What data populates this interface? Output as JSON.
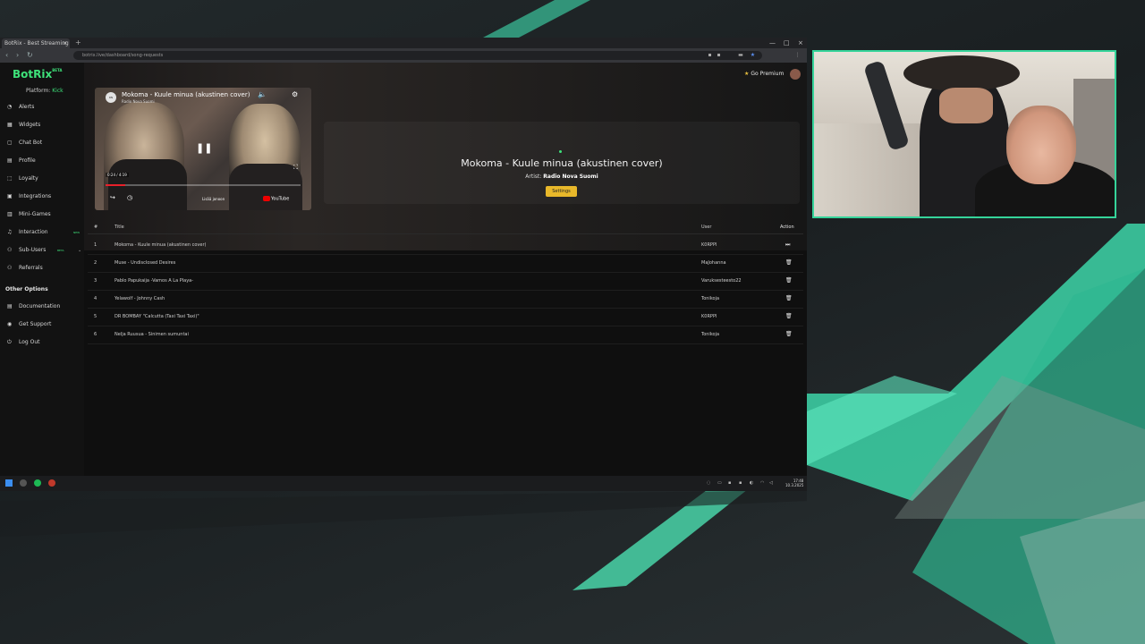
{
  "browser": {
    "tab_title": "BotRix - Best Streaming",
    "tab_close": "×",
    "new_tab": "+",
    "url": "botrix.live/dashboard/song-requests",
    "window_controls": [
      "—",
      "□",
      "×"
    ]
  },
  "app": {
    "logo": "BotRix",
    "logo_sup": "BETA",
    "platform_label": "Platform:",
    "platform_value": "Kick",
    "go_premium": "Go Premium",
    "nav": [
      {
        "label": "Alerts",
        "icon": "alerts-icon",
        "glyph": "◔"
      },
      {
        "label": "Widgets",
        "icon": "widgets-icon",
        "glyph": "▦"
      },
      {
        "label": "Chat Bot",
        "icon": "chat-bot-icon",
        "glyph": "▢"
      },
      {
        "label": "Profile",
        "icon": "profile-icon",
        "glyph": "▤"
      },
      {
        "label": "Loyalty",
        "icon": "loyalty-icon",
        "glyph": "⬚"
      },
      {
        "label": "Integrations",
        "icon": "integrations-icon",
        "glyph": "▣"
      },
      {
        "label": "Mini-Games",
        "icon": "mini-games-icon",
        "glyph": "▥"
      },
      {
        "label": "Interaction",
        "icon": "music-icon",
        "glyph": "♫",
        "badge": "NEW"
      },
      {
        "label": "Sub-Users",
        "icon": "users-icon",
        "glyph": "⚇",
        "beta": "BETA",
        "chevron": "⌄"
      },
      {
        "label": "Referrals",
        "icon": "referrals-icon",
        "glyph": "⚇"
      }
    ],
    "other_options_heading": "Other Options",
    "other_nav": [
      {
        "label": "Documentation",
        "icon": "documentation-icon",
        "glyph": "▤"
      },
      {
        "label": "Get Support",
        "icon": "support-icon",
        "glyph": "◉"
      },
      {
        "label": "Log Out",
        "icon": "logout-icon",
        "glyph": "⏻"
      }
    ]
  },
  "video": {
    "title": "Mokoma - Kuule minua (akustinen cover)",
    "channel": "Radio Nova Suomi",
    "time": "0:24 / 4:19",
    "progress": 0.1,
    "youtube_label": "YouTube",
    "later_label": "Lisää jonoon"
  },
  "now_playing": {
    "song": "Mokoma - Kuule minua (akustinen cover)",
    "artist_label": "Artist:",
    "artist": "Radio Nova Suomi",
    "settings_button": "Settings"
  },
  "queue": {
    "headers": {
      "num": "#",
      "title": "Title",
      "user": "User",
      "action": "Action"
    },
    "rows": [
      {
        "num": "1",
        "title": "Mokoma - Kuule minua (akustinen cover)",
        "user": "K0RPPI",
        "action_icon": "skip-icon",
        "glyph": "⏭"
      },
      {
        "num": "2",
        "title": "Muse - Undisclosed Desires",
        "user": "MaJohanna",
        "action_icon": "trash-icon",
        "glyph": "🗑"
      },
      {
        "num": "3",
        "title": "Pablo Papukaija -Vamos A La Playa-",
        "user": "Varuksesteesto22",
        "action_icon": "trash-icon",
        "glyph": "🗑"
      },
      {
        "num": "4",
        "title": "Yelawolf - Johnny Cash",
        "user": "Tonikoja",
        "action_icon": "trash-icon",
        "glyph": "🗑"
      },
      {
        "num": "5",
        "title": "DR BOMBAY \"Calcutta (Taxi Taxi Taxi)\"",
        "user": "K0RPPI",
        "action_icon": "trash-icon",
        "glyph": "🗑"
      },
      {
        "num": "6",
        "title": "Nelja Ruusua - Sinimen sumuntai",
        "user": "Tonikoja",
        "action_icon": "trash-icon",
        "glyph": "🗑"
      }
    ]
  },
  "taskbar": {
    "time": "17:48",
    "date": "10.3.2025"
  },
  "colors": {
    "accent": "#3ee27a",
    "settings_button": "#e8b82a",
    "webcam_border": "#35d49a",
    "stream_teal": "#3fe0b0"
  }
}
